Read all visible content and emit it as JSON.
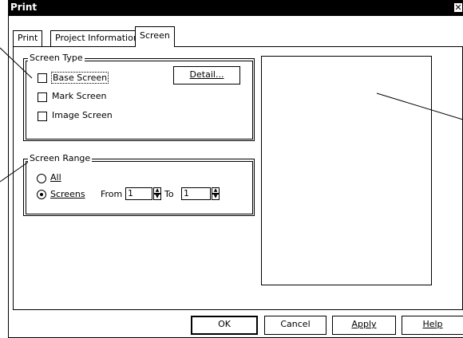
{
  "window": {
    "title": "Print",
    "close_glyph": "✕"
  },
  "tabs": [
    {
      "label": "Print"
    },
    {
      "label": "Project Information"
    },
    {
      "label": "Screen"
    }
  ],
  "screen_type": {
    "legend": "Screen Type",
    "options": [
      {
        "label": "Base Screen",
        "checked": false
      },
      {
        "label": "Mark Screen",
        "checked": false
      },
      {
        "label": "Image Screen",
        "checked": false
      }
    ],
    "detail_button": "Detail..."
  },
  "screen_range": {
    "legend": "Screen Range",
    "all_label": "All",
    "screens_label": "Screens",
    "selected": "Screens",
    "from_label": "From",
    "from_value": "1",
    "to_label": "To",
    "to_value": "1"
  },
  "buttons": {
    "ok": "OK",
    "cancel": "Cancel",
    "apply": "Apply",
    "help": "Help"
  }
}
